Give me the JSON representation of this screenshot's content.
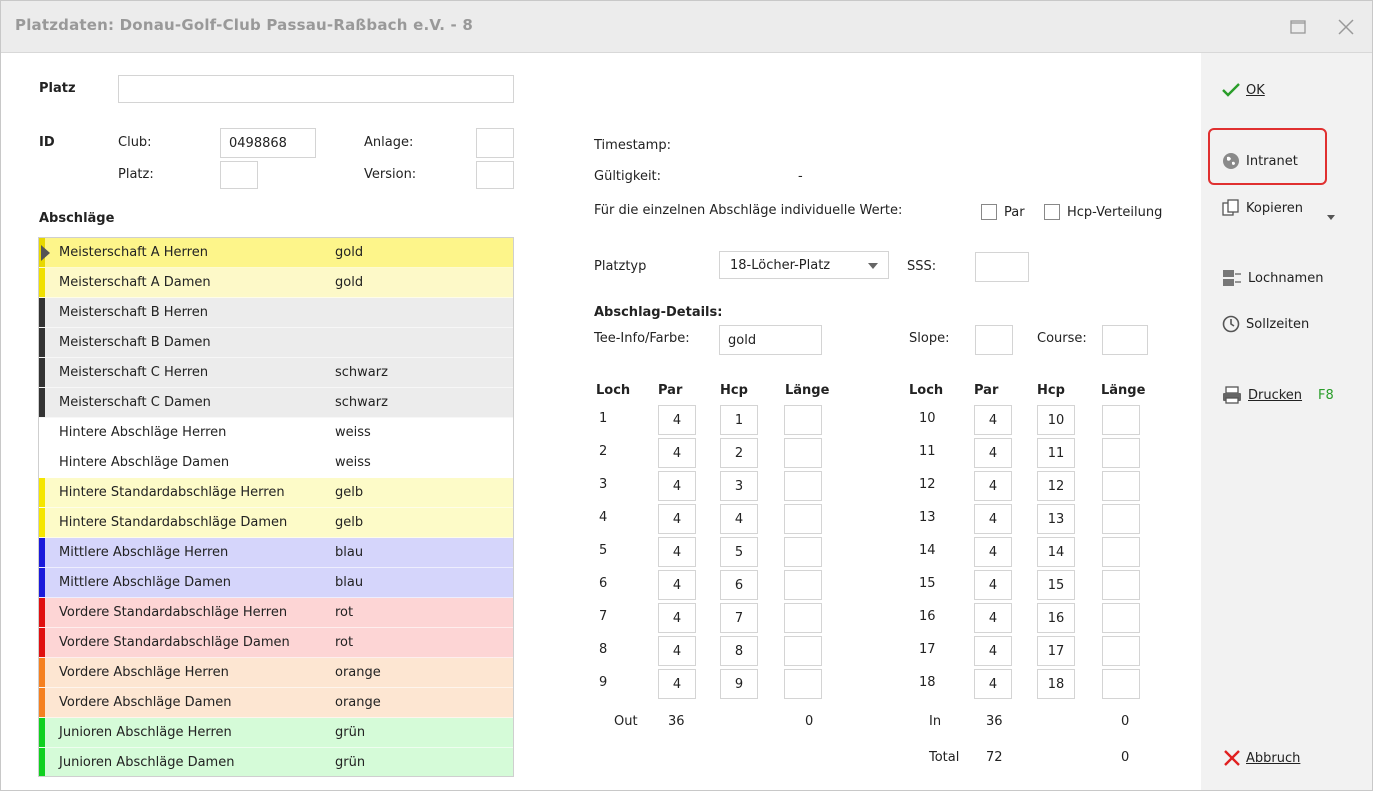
{
  "window": {
    "title": "Platzdaten: Donau-Golf-Club Passau-Raßbach e.V. - 8"
  },
  "form": {
    "platz_label": "Platz",
    "platz_value": "",
    "id_label": "ID",
    "club_label": "Club:",
    "club_value": "0498868",
    "platz2_label": "Platz:",
    "platz2_value": "",
    "anlage_label": "Anlage:",
    "anlage_value": "",
    "version_label": "Version:",
    "version_value": "",
    "abschlaege_label": "Abschläge"
  },
  "tees": [
    {
      "name": "Meisterschaft A Herren",
      "color": "gold",
      "bg": "#fdf58a",
      "stripe": "#e8d800",
      "selected": true
    },
    {
      "name": "Meisterschaft A Damen",
      "color": "gold",
      "bg": "#fdf9c8",
      "stripe": "#f0e000"
    },
    {
      "name": "Meisterschaft B Herren",
      "color": "",
      "bg": "#ececec",
      "stripe": "#333333"
    },
    {
      "name": "Meisterschaft B Damen",
      "color": "",
      "bg": "#ececec",
      "stripe": "#333333"
    },
    {
      "name": "Meisterschaft C Herren",
      "color": "schwarz",
      "bg": "#ececec",
      "stripe": "#333333"
    },
    {
      "name": "Meisterschaft C Damen",
      "color": "schwarz",
      "bg": "#ececec",
      "stripe": "#333333"
    },
    {
      "name": "Hintere Abschläge Herren",
      "color": "weiss",
      "bg": "#ffffff",
      "stripe": "#ffffff"
    },
    {
      "name": "Hintere Abschläge Damen",
      "color": "weiss",
      "bg": "#ffffff",
      "stripe": "#ffffff"
    },
    {
      "name": "Hintere Standardabschläge Herren",
      "color": "gelb",
      "bg": "#fdfbc8",
      "stripe": "#f5e600"
    },
    {
      "name": "Hintere Standardabschläge Damen",
      "color": "gelb",
      "bg": "#fdfbc8",
      "stripe": "#f5e600"
    },
    {
      "name": "Mittlere Abschläge Herren",
      "color": "blau",
      "bg": "#d5d5fb",
      "stripe": "#1a1adb"
    },
    {
      "name": "Mittlere Abschläge Damen",
      "color": "blau",
      "bg": "#d5d5fb",
      "stripe": "#1a1adb"
    },
    {
      "name": "Vordere Standardabschläge Herren",
      "color": "rot",
      "bg": "#fdd5d5",
      "stripe": "#e01010"
    },
    {
      "name": "Vordere Standardabschläge Damen",
      "color": "rot",
      "bg": "#fdd5d5",
      "stripe": "#e01010"
    },
    {
      "name": "Vordere Abschläge Herren",
      "color": "orange",
      "bg": "#fde6d2",
      "stripe": "#f58020"
    },
    {
      "name": "Vordere Abschläge Damen",
      "color": "orange",
      "bg": "#fde6d2",
      "stripe": "#f58020"
    },
    {
      "name": "Junioren Abschläge Herren",
      "color": "grün",
      "bg": "#d5fbd8",
      "stripe": "#10d020"
    },
    {
      "name": "Junioren Abschläge Damen",
      "color": "grün",
      "bg": "#d5fbd8",
      "stripe": "#10d020"
    }
  ],
  "info": {
    "timestamp_label": "Timestamp:",
    "gueltigkeit_label": "Gültigkeit:",
    "gueltigkeit_value": "-",
    "individual_label": "Für die einzelnen Abschläge individuelle Werte:",
    "par_cb_label": "Par",
    "hcp_cb_label": "Hcp-Verteilung",
    "platztyp_label": "Platztyp",
    "platztyp_value": "18-Löcher-Platz",
    "sss_label": "SSS:",
    "sss_value": "",
    "details_label": "Abschlag-Details:",
    "teeinfo_label": "Tee-Info/Farbe:",
    "teeinfo_value": "gold",
    "slope_label": "Slope:",
    "slope_value": "",
    "course_label": "Course:",
    "course_value": ""
  },
  "holes": {
    "headers": {
      "loch": "Loch",
      "par": "Par",
      "hcp": "Hcp",
      "laenge": "Länge"
    },
    "front": [
      {
        "loch": "1",
        "par": "4",
        "hcp": "1",
        "laenge": ""
      },
      {
        "loch": "2",
        "par": "4",
        "hcp": "2",
        "laenge": ""
      },
      {
        "loch": "3",
        "par": "4",
        "hcp": "3",
        "laenge": ""
      },
      {
        "loch": "4",
        "par": "4",
        "hcp": "4",
        "laenge": ""
      },
      {
        "loch": "5",
        "par": "4",
        "hcp": "5",
        "laenge": ""
      },
      {
        "loch": "6",
        "par": "4",
        "hcp": "6",
        "laenge": ""
      },
      {
        "loch": "7",
        "par": "4",
        "hcp": "7",
        "laenge": ""
      },
      {
        "loch": "8",
        "par": "4",
        "hcp": "8",
        "laenge": ""
      },
      {
        "loch": "9",
        "par": "4",
        "hcp": "9",
        "laenge": ""
      }
    ],
    "back": [
      {
        "loch": "10",
        "par": "4",
        "hcp": "10",
        "laenge": ""
      },
      {
        "loch": "11",
        "par": "4",
        "hcp": "11",
        "laenge": ""
      },
      {
        "loch": "12",
        "par": "4",
        "hcp": "12",
        "laenge": ""
      },
      {
        "loch": "13",
        "par": "4",
        "hcp": "13",
        "laenge": ""
      },
      {
        "loch": "14",
        "par": "4",
        "hcp": "14",
        "laenge": ""
      },
      {
        "loch": "15",
        "par": "4",
        "hcp": "15",
        "laenge": ""
      },
      {
        "loch": "16",
        "par": "4",
        "hcp": "16",
        "laenge": ""
      },
      {
        "loch": "17",
        "par": "4",
        "hcp": "17",
        "laenge": ""
      },
      {
        "loch": "18",
        "par": "4",
        "hcp": "18",
        "laenge": ""
      }
    ],
    "out_label": "Out",
    "out_par": "36",
    "out_len": "0",
    "in_label": "In",
    "in_par": "36",
    "in_len": "0",
    "total_label": "Total",
    "total_par": "72",
    "total_len": "0"
  },
  "sidebar": {
    "ok": "OK",
    "intranet": "Intranet",
    "kopieren": "Kopieren",
    "lochnamen": "Lochnamen",
    "sollzeiten": "Sollzeiten",
    "drucken": "Drucken",
    "drucken_key": "F8",
    "abbruch": "Abbruch"
  },
  "colors": {
    "accent_green": "#2a9d2a",
    "cancel_red": "#e02020",
    "highlight_red": "#e03030"
  }
}
